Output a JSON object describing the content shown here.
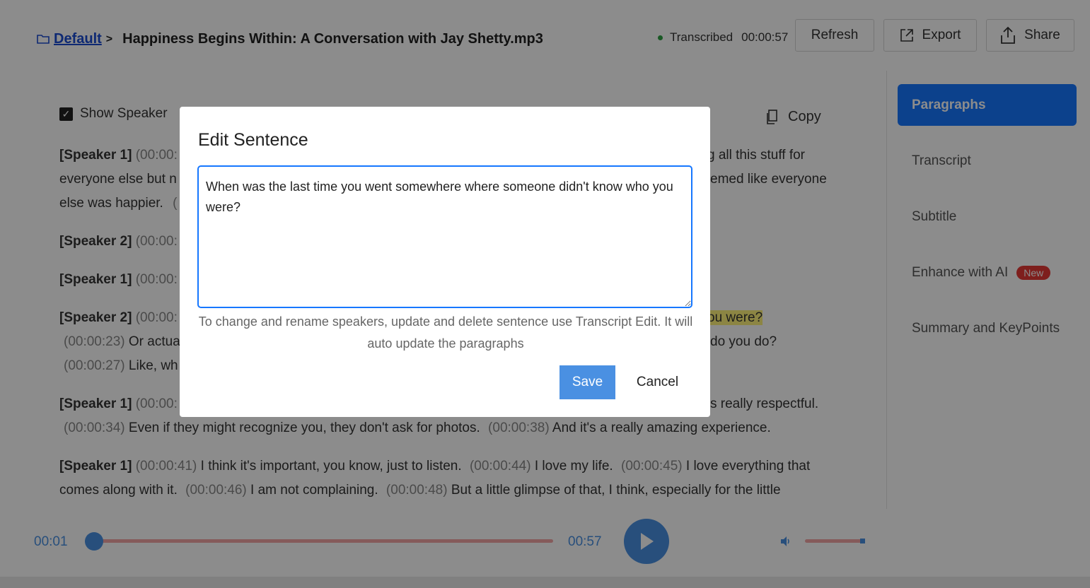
{
  "header": {
    "breadcrumb_link": "Default",
    "breadcrumb_sep": ">",
    "title": "Happiness Begins Within: A Conversation with Jay Shetty.mp3",
    "status": "Transcribed",
    "duration": "00:00:57",
    "refresh_label": "Refresh",
    "export_label": "Export",
    "share_label": "Share"
  },
  "toolbar": {
    "show_speaker_label": "Show Speaker",
    "show_speaker_checked": true,
    "copy_label": "Copy"
  },
  "transcript": {
    "p1": {
      "speaker": "[Speaker 1]",
      "ts1": "(00:00:",
      "t1": "g all this stuff for",
      "l2a": "everyone else but n",
      "l2b": "emed like everyone",
      "l3a": "else was happier.",
      "l3b": "("
    },
    "p2": {
      "speaker": "[Speaker 2]",
      "ts1": "(00:00:"
    },
    "p3": {
      "speaker": "[Speaker 1]",
      "ts1": "(00:00:"
    },
    "p4": {
      "speaker": "[Speaker 2]",
      "ts1": "(00:00:",
      "hl": "ou were?",
      "ts2": "(00:00:23)",
      "t2": "Or actua",
      "t2b": "do you do?",
      "ts3": "(00:00:27)",
      "t3": "Like, wh"
    },
    "p5": {
      "speaker": "[Speaker 1]",
      "ts1": "(00:00:",
      "t1b": "s really respectful.",
      "ts2": "(00:00:34)",
      "t2": "Even if they might recognize you, they don't ask for photos.",
      "ts3": "(00:00:38)",
      "t3": "And it's a really amazing experience."
    },
    "p6": {
      "speaker": "[Speaker 1]",
      "ts1": "(00:00:41)",
      "t1": "I think it's important, you know, just to listen.",
      "ts2": "(00:00:44)",
      "t2": "I love my life.",
      "ts3": "(00:00:45)",
      "t3": "I love everything that",
      "t4": "comes along with it.",
      "ts4": "(00:00:46)",
      "t5": "I am not complaining.",
      "ts5": "(00:00:48)",
      "t6": "But a little glimpse of that, I think, especially for the little"
    }
  },
  "sidebar": {
    "items": [
      {
        "label": "Paragraphs",
        "active": true
      },
      {
        "label": "Transcript"
      },
      {
        "label": "Subtitle"
      },
      {
        "label": "Enhance with AI",
        "badge": "New"
      },
      {
        "label": "Summary and KeyPoints"
      }
    ]
  },
  "modal": {
    "title": "Edit Sentence",
    "text": "When was the last time you went somewhere where someone didn't know who you were?",
    "hint": "To change and rename speakers, update and delete sentence use Transcript Edit. It will auto update the paragraphs",
    "save_label": "Save",
    "cancel_label": "Cancel"
  },
  "player": {
    "current": "00:01",
    "total": "00:57",
    "progress_fraction": 0.017,
    "volume_fraction": 1.0
  },
  "colors": {
    "accent": "#1677ff",
    "player_blue": "#4a90e2",
    "track": "#f2a7a7",
    "badge": "#e53935",
    "highlight": "#fff27a"
  }
}
